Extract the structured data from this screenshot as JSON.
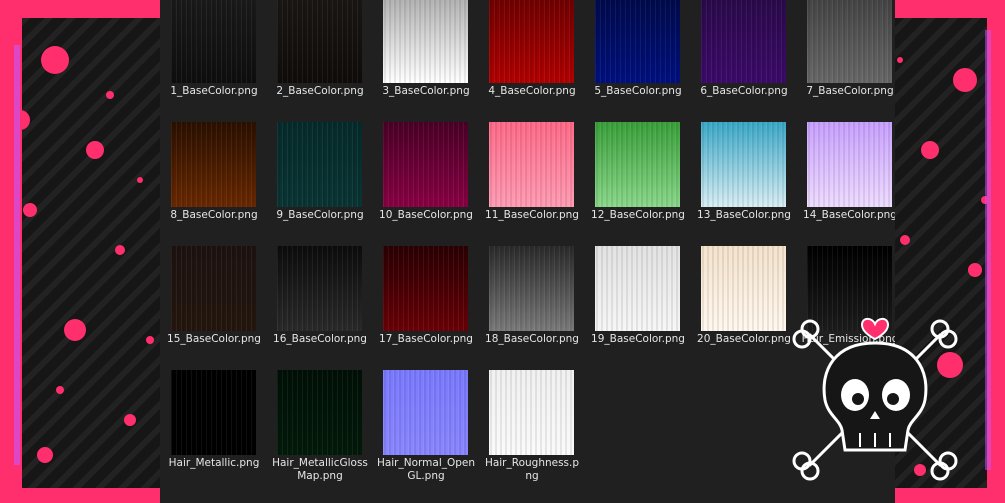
{
  "colors": {
    "frame_accent": "#ff2f6e",
    "panel_background": "#202020",
    "label_text": "#e6e6e6"
  },
  "files": [
    {
      "name": "1_BaseColor.png",
      "top": "#1a1a1a",
      "bottom": "#0e0e0e"
    },
    {
      "name": "2_BaseColor.png",
      "top": "#1a1614",
      "bottom": "#100c0a"
    },
    {
      "name": "3_BaseColor.png",
      "top": "#b0b0b0",
      "bottom": "#ffffff"
    },
    {
      "name": "4_BaseColor.png",
      "top": "#6e0000",
      "bottom": "#b30000"
    },
    {
      "name": "5_BaseColor.png",
      "top": "#000a4a",
      "bottom": "#001080"
    },
    {
      "name": "6_BaseColor.png",
      "top": "#2a0a4a",
      "bottom": "#3c0a6a"
    },
    {
      "name": "7_BaseColor.png",
      "top": "#444444",
      "bottom": "#686868"
    },
    {
      "name": "8_BaseColor.png",
      "top": "#2a1000",
      "bottom": "#6a2800"
    },
    {
      "name": "9_BaseColor.png",
      "top": "#052a2a",
      "bottom": "#0a3434"
    },
    {
      "name": "10_BaseColor.png",
      "top": "#4a0026",
      "bottom": "#8a0044"
    },
    {
      "name": "11_BaseColor.png",
      "top": "#ff6a88",
      "bottom": "#ff9cb4"
    },
    {
      "name": "12_BaseColor.png",
      "top": "#3aa03a",
      "bottom": "#8ad88a"
    },
    {
      "name": "13_BaseColor.png",
      "top": "#3aa8c8",
      "bottom": "#d8eef4"
    },
    {
      "name": "14_BaseColor.png",
      "top": "#c8a0ff",
      "bottom": "#eedcff"
    },
    {
      "name": "15_BaseColor.png",
      "top": "#1c1210",
      "bottom": "#24160e"
    },
    {
      "name": "16_BaseColor.png",
      "top": "#0c0c0c",
      "bottom": "#2a2a2a"
    },
    {
      "name": "17_BaseColor.png",
      "top": "#2a0002",
      "bottom": "#6a0006"
    },
    {
      "name": "18_BaseColor.png",
      "top": "#2a2a2a",
      "bottom": "#7a7a7a"
    },
    {
      "name": "19_BaseColor.png",
      "top": "#e2e2e2",
      "bottom": "#f6f6f6"
    },
    {
      "name": "20_BaseColor.png",
      "top": "#f4e2cc",
      "bottom": "#fff8ee"
    },
    {
      "name": "Hair_Emission.png",
      "top": "#000000",
      "bottom": "#1c1c1c"
    },
    {
      "name": "Hair_Metallic.png",
      "top": "#000000",
      "bottom": "#000000"
    },
    {
      "name": "Hair_MetallicGlossMap.png",
      "top": "#001006",
      "bottom": "#021a0a"
    },
    {
      "name": "Hair_Normal_OpenGL.png",
      "top": "#7a7aff",
      "bottom": "#8a86ff"
    },
    {
      "name": "Hair_Roughness.png",
      "top": "#f0f0f0",
      "bottom": "#fafafa"
    }
  ]
}
